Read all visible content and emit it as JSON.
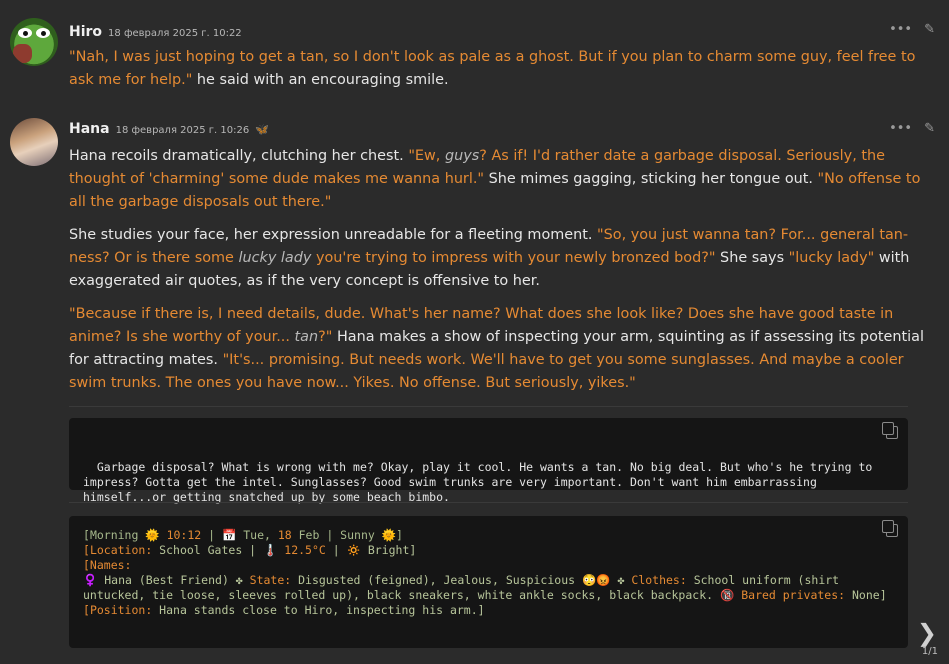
{
  "messages": [
    {
      "name": "Hiro",
      "date": "18 февраля 2025 г. 10:22",
      "text_parts": [
        {
          "t": "\"Nah, I was just hoping to get a tan, so I don't look as pale as a ghost. But if you plan to charm some guy, feel free to ask me for help.\"",
          "q": true
        },
        {
          "t": " he said with an encouraging smile.",
          "q": false
        }
      ]
    },
    {
      "name": "Hana",
      "date": "18 февраля 2025 г. 10:26",
      "paragraphs": [
        [
          {
            "t": "Hana recoils dramatically, clutching her chest. ",
            "q": false
          },
          {
            "t": "\"Ew, ",
            "q": true
          },
          {
            "t": "guys",
            "q": "em"
          },
          {
            "t": "? As if! I'd rather date a garbage disposal. Seriously, the thought of 'charming' some dude makes me wanna hurl.\"",
            "q": true
          },
          {
            "t": " She mimes gagging, sticking her tongue out. ",
            "q": false
          },
          {
            "t": "\"No offense to all the garbage disposals out there.\"",
            "q": true
          }
        ],
        [
          {
            "t": "She studies your face, her expression unreadable for a fleeting moment. ",
            "q": false
          },
          {
            "t": "\"So, you just wanna tan? For... general tan-ness? Or is there some ",
            "q": true
          },
          {
            "t": "lucky lady",
            "q": "em"
          },
          {
            "t": " you're trying to impress with your newly bronzed bod?\"",
            "q": true
          },
          {
            "t": " She says ",
            "q": false
          },
          {
            "t": "\"lucky lady\"",
            "q": true
          },
          {
            "t": " with exaggerated air quotes, as if the very concept is offensive to her.",
            "q": false
          }
        ],
        [
          {
            "t": "\"Because if there is, I need details, dude. What's her name? What does she look like? Does she have good taste in anime? Is she worthy of your... ",
            "q": true
          },
          {
            "t": "tan",
            "q": "em"
          },
          {
            "t": "?\"",
            "q": true
          },
          {
            "t": " Hana makes a show of inspecting your arm, squinting as if assessing its potential for attracting mates. ",
            "q": false
          },
          {
            "t": "\"It's... promising. But needs work. We'll have to get you some sunglasses. And maybe a cooler swim trunks. The ones you have now... Yikes. No offense. But seriously, yikes.\"",
            "q": true
          }
        ]
      ],
      "thought": "Garbage disposal? What is wrong with me? Okay, play it cool. He wants a tan. No big deal. But who's he trying to impress? Gotta get the intel. Sunglasses? Good swim trunks are very important. Don't want him embarrassing himself...or getting snatched up by some beach bimbo.",
      "status_lines": [
        [
          {
            "t": "[",
            "c": "g"
          },
          {
            "t": "Morning 🌞 ",
            "c": "g"
          },
          {
            "t": "10:12",
            "c": "k"
          },
          {
            "t": " | 📅 Tue, ",
            "c": "g"
          },
          {
            "t": "18",
            "c": "k"
          },
          {
            "t": " Feb | Sunny 🌞]",
            "c": "g"
          }
        ],
        [
          {
            "t": "[",
            "c": "k"
          },
          {
            "t": "Location:",
            "c": "k"
          },
          {
            "t": " School Gates | 🌡️ ",
            "c": "v"
          },
          {
            "t": "12.5°C",
            "c": "k"
          },
          {
            "t": " | 🔅 Bright]",
            "c": "v"
          }
        ],
        [
          {
            "t": "[Names:",
            "c": "k"
          }
        ],
        [
          {
            "t": "♀️ Hana (Best Friend) ✤ ",
            "c": "v"
          },
          {
            "t": "State:",
            "c": "k"
          },
          {
            "t": " Disgusted (feigned), Jealous, Suspicious 😳😡 ✤ ",
            "c": "v"
          },
          {
            "t": "Clothes:",
            "c": "k"
          },
          {
            "t": " School uniform (shirt untucked, tie loose, sleeves rolled up), black sneakers, white ankle socks, black backpack. 🔞 ",
            "c": "v"
          },
          {
            "t": "Bared privates:",
            "c": "k"
          },
          {
            "t": " None]",
            "c": "v"
          }
        ],
        [
          {
            "t": "[",
            "c": "k"
          },
          {
            "t": "Position:",
            "c": "k"
          },
          {
            "t": " Hana stands close to Hiro, inspecting his arm.]",
            "c": "v"
          }
        ]
      ]
    }
  ],
  "footer": {
    "swipe_counter": "1/1"
  },
  "icons": {
    "more": "more-icon",
    "edit": "edit-icon",
    "copy": "copy-icon",
    "next": "chevron-right-icon",
    "butterfly": "butterfly-icon"
  }
}
